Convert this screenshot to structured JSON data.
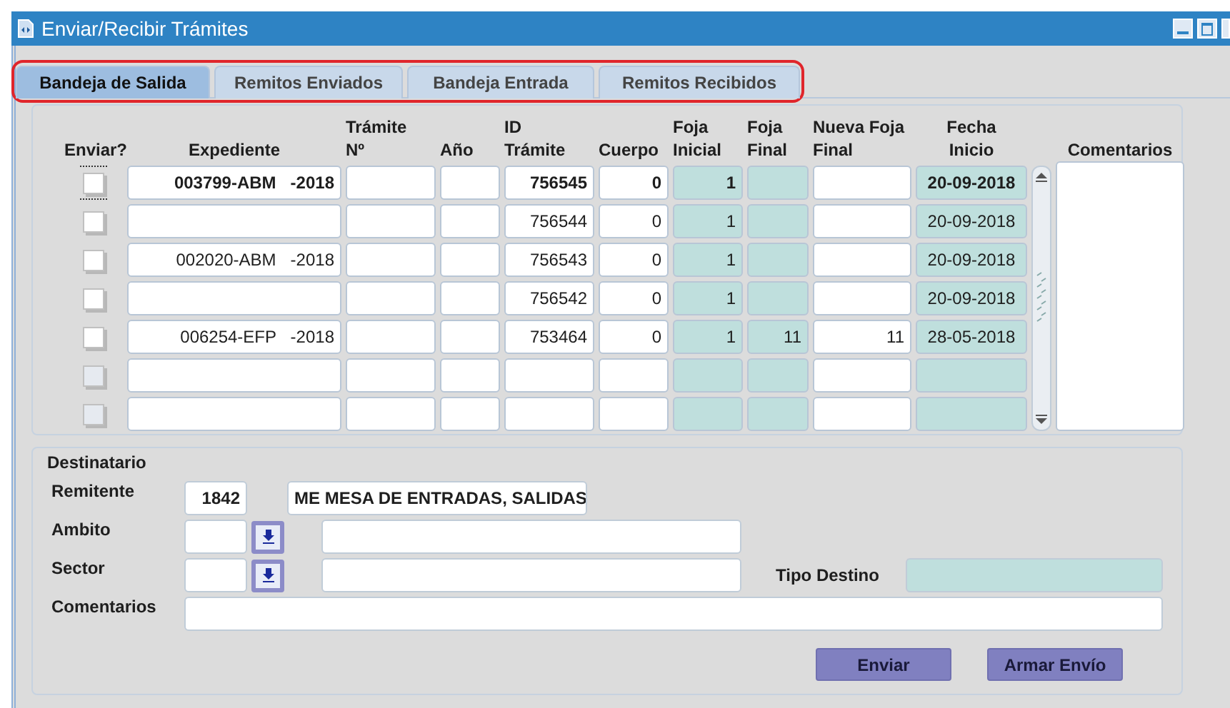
{
  "window": {
    "title": "Enviar/Recibir Trámites"
  },
  "tabs": [
    {
      "label": "Bandeja de Salida",
      "selected": true
    },
    {
      "label": "Remitos Enviados",
      "selected": false
    },
    {
      "label": "Bandeja Entrada",
      "selected": false
    },
    {
      "label": "Remitos Recibidos",
      "selected": false
    }
  ],
  "table": {
    "columns": [
      "Enviar?",
      "Expediente",
      "Trámite\nNº",
      "Año",
      "ID\nTrámite",
      "Cuerpo",
      "Foja\nInicial",
      "Foja\nFinal",
      "Nueva Foja\nFinal",
      "Fecha\nInicio",
      "Comentarios"
    ],
    "rows": [
      {
        "current": true,
        "cells": [
          {
            "kind": "checkbox",
            "checked": false,
            "disabled": false
          },
          {
            "kind": "text",
            "text": "003799-ABM   -2018",
            "readonly": false
          },
          {
            "kind": "text",
            "text": "",
            "readonly": false
          },
          {
            "kind": "text",
            "text": "",
            "readonly": false
          },
          {
            "kind": "text",
            "text": "756545",
            "readonly": false
          },
          {
            "kind": "text",
            "text": "0",
            "readonly": false
          },
          {
            "kind": "text",
            "text": "1",
            "readonly": true
          },
          {
            "kind": "text",
            "text": "",
            "readonly": true
          },
          {
            "kind": "text",
            "text": "",
            "readonly": false
          },
          {
            "kind": "text",
            "text": "20-09-2018",
            "readonly": true
          }
        ]
      },
      {
        "current": false,
        "cells": [
          {
            "kind": "checkbox",
            "checked": false,
            "disabled": false
          },
          {
            "kind": "text",
            "text": "",
            "readonly": false
          },
          {
            "kind": "text",
            "text": "",
            "readonly": false
          },
          {
            "kind": "text",
            "text": "",
            "readonly": false
          },
          {
            "kind": "text",
            "text": "756544",
            "readonly": false
          },
          {
            "kind": "text",
            "text": "0",
            "readonly": false
          },
          {
            "kind": "text",
            "text": "1",
            "readonly": true
          },
          {
            "kind": "text",
            "text": "",
            "readonly": true
          },
          {
            "kind": "text",
            "text": "",
            "readonly": false
          },
          {
            "kind": "text",
            "text": "20-09-2018",
            "readonly": true
          }
        ]
      },
      {
        "current": false,
        "cells": [
          {
            "kind": "checkbox",
            "checked": false,
            "disabled": false
          },
          {
            "kind": "text",
            "text": "002020-ABM   -2018",
            "readonly": false
          },
          {
            "kind": "text",
            "text": "",
            "readonly": false
          },
          {
            "kind": "text",
            "text": "",
            "readonly": false
          },
          {
            "kind": "text",
            "text": "756543",
            "readonly": false
          },
          {
            "kind": "text",
            "text": "0",
            "readonly": false
          },
          {
            "kind": "text",
            "text": "1",
            "readonly": true
          },
          {
            "kind": "text",
            "text": "",
            "readonly": true
          },
          {
            "kind": "text",
            "text": "",
            "readonly": false
          },
          {
            "kind": "text",
            "text": "20-09-2018",
            "readonly": true
          }
        ]
      },
      {
        "current": false,
        "cells": [
          {
            "kind": "checkbox",
            "checked": false,
            "disabled": false
          },
          {
            "kind": "text",
            "text": "",
            "readonly": false
          },
          {
            "kind": "text",
            "text": "",
            "readonly": false
          },
          {
            "kind": "text",
            "text": "",
            "readonly": false
          },
          {
            "kind": "text",
            "text": "756542",
            "readonly": false
          },
          {
            "kind": "text",
            "text": "0",
            "readonly": false
          },
          {
            "kind": "text",
            "text": "1",
            "readonly": true
          },
          {
            "kind": "text",
            "text": "",
            "readonly": true
          },
          {
            "kind": "text",
            "text": "",
            "readonly": false
          },
          {
            "kind": "text",
            "text": "20-09-2018",
            "readonly": true
          }
        ]
      },
      {
        "current": false,
        "cells": [
          {
            "kind": "checkbox",
            "checked": false,
            "disabled": false
          },
          {
            "kind": "text",
            "text": "006254-EFP   -2018",
            "readonly": false
          },
          {
            "kind": "text",
            "text": "",
            "readonly": false
          },
          {
            "kind": "text",
            "text": "",
            "readonly": false
          },
          {
            "kind": "text",
            "text": "753464",
            "readonly": false
          },
          {
            "kind": "text",
            "text": "0",
            "readonly": false
          },
          {
            "kind": "text",
            "text": "1",
            "readonly": true
          },
          {
            "kind": "text",
            "text": "11",
            "readonly": true
          },
          {
            "kind": "text",
            "text": "11",
            "readonly": false
          },
          {
            "kind": "text",
            "text": "28-05-2018",
            "readonly": true
          }
        ]
      },
      {
        "current": false,
        "cells": [
          {
            "kind": "checkbox",
            "checked": false,
            "disabled": true
          },
          {
            "kind": "text",
            "text": "",
            "readonly": false
          },
          {
            "kind": "text",
            "text": "",
            "readonly": false
          },
          {
            "kind": "text",
            "text": "",
            "readonly": false
          },
          {
            "kind": "text",
            "text": "",
            "readonly": false
          },
          {
            "kind": "text",
            "text": "",
            "readonly": false
          },
          {
            "kind": "text",
            "text": "",
            "readonly": true
          },
          {
            "kind": "text",
            "text": "",
            "readonly": true
          },
          {
            "kind": "text",
            "text": "",
            "readonly": false
          },
          {
            "kind": "text",
            "text": "",
            "readonly": true
          }
        ]
      },
      {
        "current": false,
        "cells": [
          {
            "kind": "checkbox",
            "checked": false,
            "disabled": true
          },
          {
            "kind": "text",
            "text": "",
            "readonly": false
          },
          {
            "kind": "text",
            "text": "",
            "readonly": false
          },
          {
            "kind": "text",
            "text": "",
            "readonly": false
          },
          {
            "kind": "text",
            "text": "",
            "readonly": false
          },
          {
            "kind": "text",
            "text": "",
            "readonly": false
          },
          {
            "kind": "text",
            "text": "",
            "readonly": true
          },
          {
            "kind": "text",
            "text": "",
            "readonly": true
          },
          {
            "kind": "text",
            "text": "",
            "readonly": false
          },
          {
            "kind": "text",
            "text": "",
            "readonly": true
          }
        ]
      }
    ]
  },
  "destinatario": {
    "title": "Destinatario",
    "remitente": {
      "label": "Remitente",
      "code": "1842",
      "name": "ME MESA DE ENTRADAS, SALIDAS"
    },
    "ambito": {
      "label": "Ambito"
    },
    "sector": {
      "label": "Sector"
    },
    "tipo_destino": {
      "label": "Tipo Destino"
    },
    "comentarios": {
      "label": "Comentarios"
    }
  },
  "buttons": [
    "Enviar",
    "Armar Envío"
  ]
}
